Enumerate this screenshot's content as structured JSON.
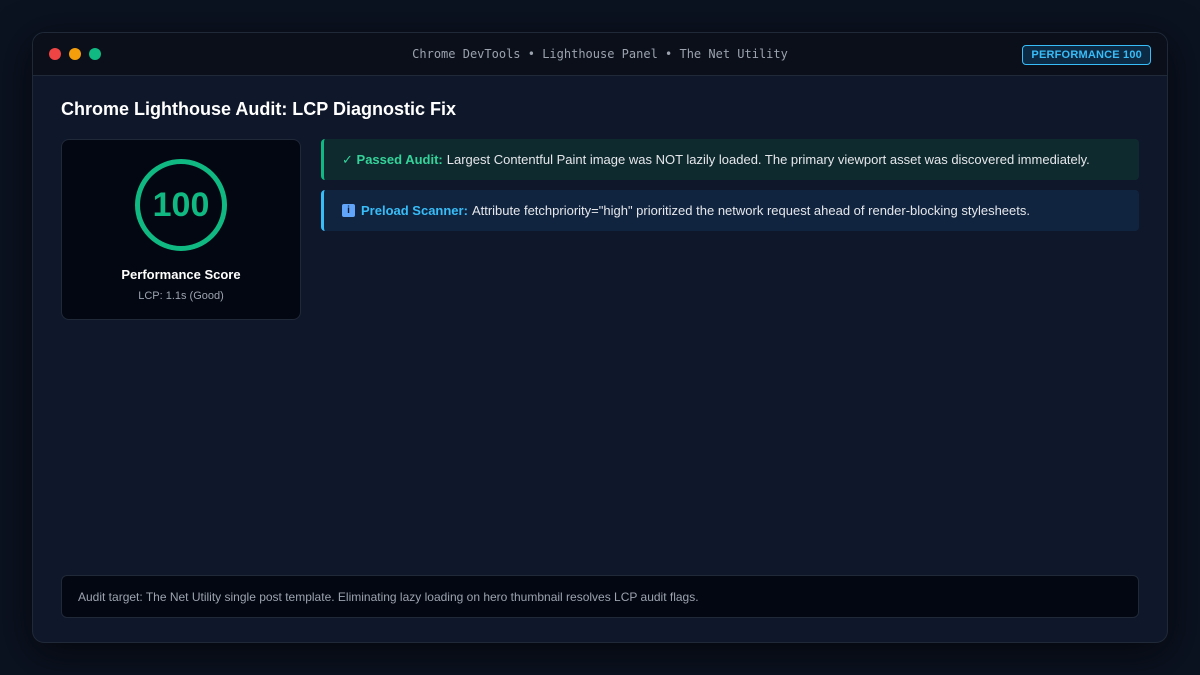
{
  "window": {
    "title": "Chrome DevTools • Lighthouse Panel • The Net Utility",
    "badge": "PERFORMANCE 100"
  },
  "page": {
    "title": "Chrome Lighthouse Audit: LCP Diagnostic Fix"
  },
  "score_card": {
    "value": "100",
    "label": "Performance Score",
    "metric": "LCP: 1.1s (Good)",
    "color": "#10b981"
  },
  "alerts": [
    {
      "type": "success",
      "icon": "check-icon",
      "icon_glyph": "✓",
      "lead": "Passed Audit:",
      "text": "Largest Contentful Paint image was NOT lazily loaded. The primary viewport asset was discovered immediately."
    },
    {
      "type": "info",
      "icon": "info-icon",
      "icon_glyph": "i",
      "lead": "Preload Scanner:",
      "text": "Attribute fetchpriority=\"high\" prioritized the network request ahead of render-blocking stylesheets."
    }
  ],
  "footer": {
    "note": "Audit target: The Net Utility single post template. Eliminating lazy loading on hero thumbnail resolves LCP audit flags."
  },
  "colors": {
    "accent_success": "#10b981",
    "accent_info": "#38bdf8"
  }
}
